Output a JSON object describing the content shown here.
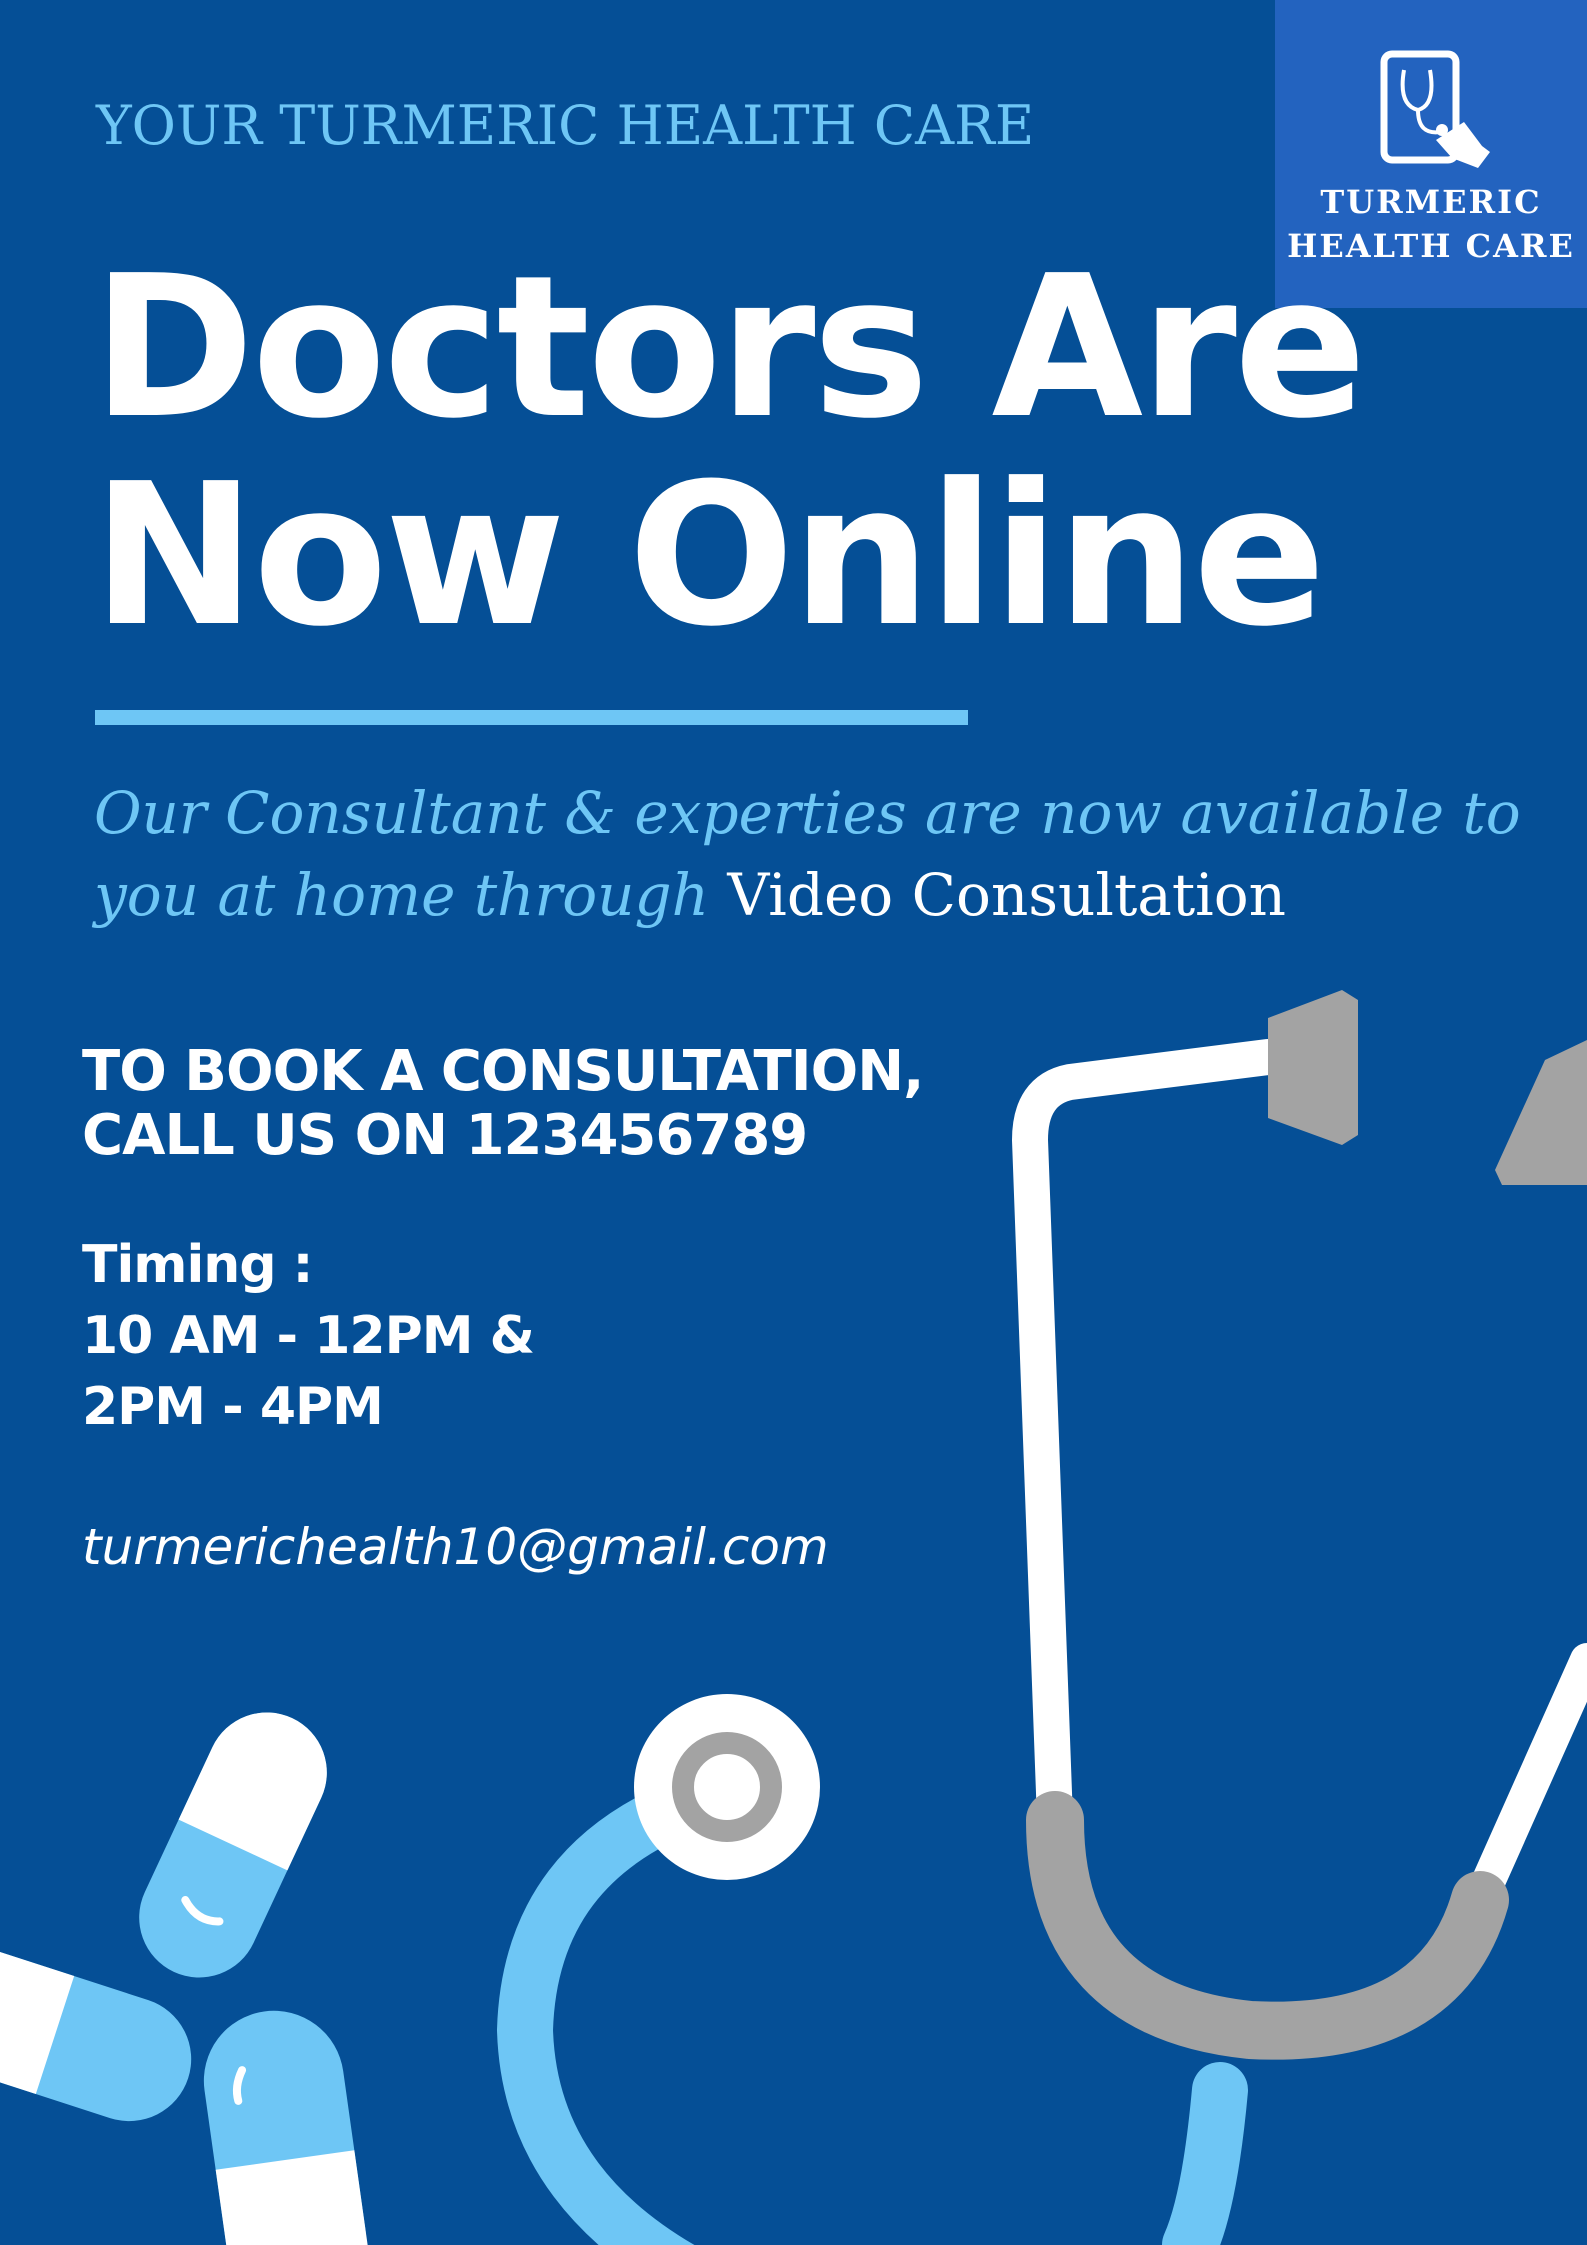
{
  "eyebrow": "YOUR TURMERIC HEALTH CARE",
  "headline": {
    "line1": "Doctors Are",
    "line2": "Now Online"
  },
  "tagline": {
    "part1": "Our Consultant & experties are now available to you at home through",
    "part2": "Video Consultation"
  },
  "booking": {
    "line1": "TO BOOK A CONSULTATION,",
    "line2": "CALL US ON 123456789"
  },
  "timing": {
    "label": "Timing :",
    "slot1": "10 AM - 12PM &",
    "slot2": "2PM - 4PM"
  },
  "email": "turmerichealth10@gmail.com",
  "logo": {
    "line1": "TURMERIC",
    "line2": "HEALTH CARE",
    "icon": "tablet-stethoscope-icon"
  },
  "colors": {
    "background": "#054f96",
    "accent": "#6ec6f5",
    "logo_box": "#2363bf",
    "gray": "#a3a3a3",
    "white": "#ffffff"
  }
}
